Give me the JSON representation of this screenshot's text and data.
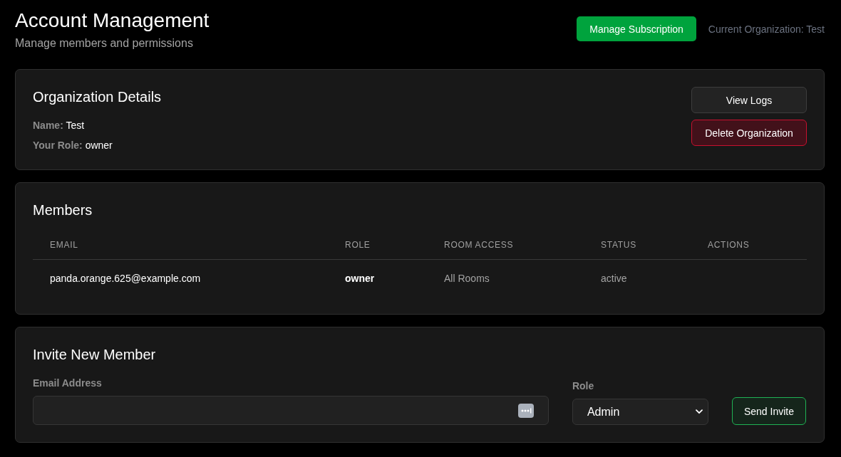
{
  "header": {
    "title": "Account Management",
    "subtitle": "Manage members and permissions",
    "subscription_button": "Manage Subscription",
    "current_organization": "Current Organization: Test"
  },
  "organization_details": {
    "title": "Organization Details",
    "fields": [
      {
        "label": "Name:",
        "value": "Test"
      },
      {
        "label": "Your Role:",
        "value": "owner"
      }
    ],
    "buttons": [
      {
        "label": "View Logs",
        "kind": "secondary"
      },
      {
        "label": "Delete Organization",
        "kind": "danger"
      }
    ]
  },
  "members": {
    "title": "Members",
    "table": {
      "columns": [
        "EMAIL",
        "ROLE",
        "ROOM ACCESS",
        "STATUS",
        "ACTIONS"
      ],
      "rows": [
        {
          "cells": [
            "panda.orange.625@example.com",
            "owner",
            "All Rooms",
            "active"
          ]
        }
      ]
    }
  },
  "invite": {
    "title": "Invite New Member",
    "email_label": "Email Address",
    "role_label": "Role",
    "role_value": "Admin",
    "button": "Send Invite"
  }
}
